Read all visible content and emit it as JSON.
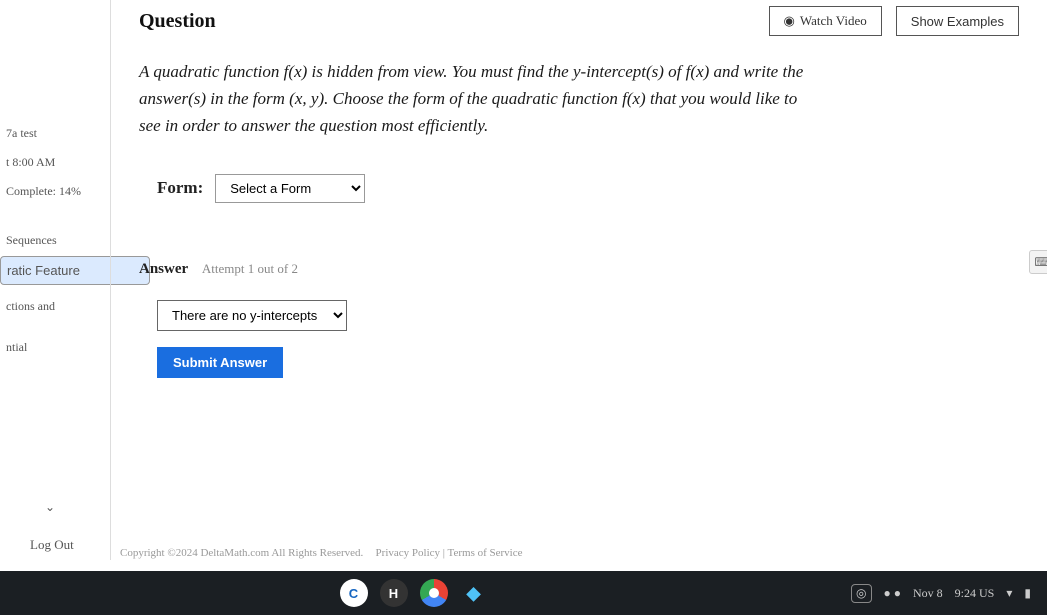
{
  "sidebar": {
    "items": [
      {
        "label": "7a test"
      },
      {
        "label": "t 8:00 AM"
      },
      {
        "label": "Complete: 14%"
      },
      {
        "label": "Sequences"
      },
      {
        "label": "ratic Feature"
      },
      {
        "label": "ctions and"
      },
      {
        "label": "ntial"
      }
    ],
    "logout": "Log Out"
  },
  "header": {
    "title": "Question",
    "watch": "Watch Video",
    "examples": "Show Examples"
  },
  "prompt": {
    "text": "A quadratic function f(x) is hidden from view. You must find the y-intercept(s) of f(x) and write the answer(s) in the form (x, y). Choose the form of the quadratic function f(x) that you would like to see in order to answer the question most efficiently."
  },
  "form": {
    "label": "Form:",
    "placeholder": "Select a Form"
  },
  "answer": {
    "label": "Answer",
    "attempt": "Attempt 1 out of 2",
    "select_value": "There are no y-intercepts",
    "submit": "Submit Answer"
  },
  "footer": {
    "copyright": "Copyright ©2024 DeltaMath.com All Rights Reserved.",
    "links": "Privacy Policy | Terms of Service"
  },
  "shelf": {
    "date": "Nov 8",
    "time": "9:24 US"
  }
}
